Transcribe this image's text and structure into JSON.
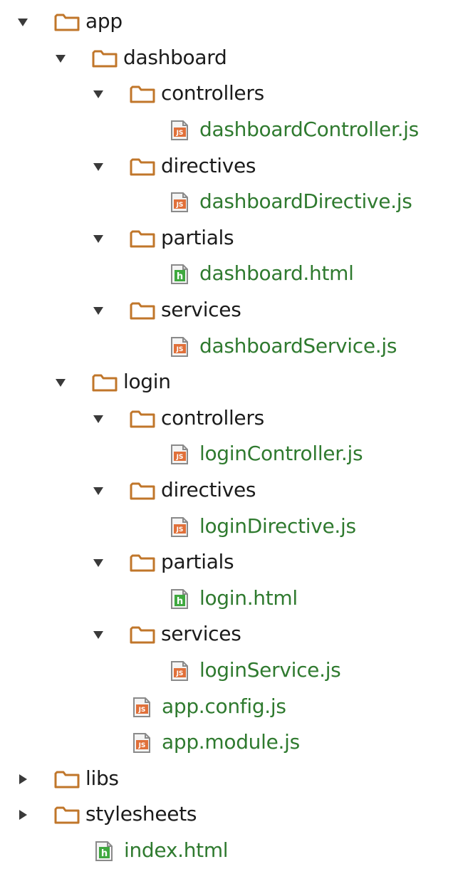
{
  "tree": [
    {
      "label": "app",
      "type": "folder",
      "depth": 0,
      "expanded": true
    },
    {
      "label": "dashboard",
      "type": "folder",
      "depth": 1,
      "expanded": true
    },
    {
      "label": "controllers",
      "type": "folder",
      "depth": 2,
      "expanded": true
    },
    {
      "label": "dashboardController.js",
      "type": "js",
      "depth": 3
    },
    {
      "label": "directives",
      "type": "folder",
      "depth": 2,
      "expanded": true
    },
    {
      "label": "dashboardDirective.js",
      "type": "js",
      "depth": 3
    },
    {
      "label": "partials",
      "type": "folder",
      "depth": 2,
      "expanded": true
    },
    {
      "label": "dashboard.html",
      "type": "html",
      "depth": 3
    },
    {
      "label": "services",
      "type": "folder",
      "depth": 2,
      "expanded": true
    },
    {
      "label": "dashboardService.js",
      "type": "js",
      "depth": 3
    },
    {
      "label": "login",
      "type": "folder",
      "depth": 1,
      "expanded": true
    },
    {
      "label": "controllers",
      "type": "folder",
      "depth": 2,
      "expanded": true
    },
    {
      "label": "loginController.js",
      "type": "js",
      "depth": 3
    },
    {
      "label": "directives",
      "type": "folder",
      "depth": 2,
      "expanded": true
    },
    {
      "label": "loginDirective.js",
      "type": "js",
      "depth": 3
    },
    {
      "label": "partials",
      "type": "folder",
      "depth": 2,
      "expanded": true
    },
    {
      "label": "login.html",
      "type": "html",
      "depth": 3
    },
    {
      "label": "services",
      "type": "folder",
      "depth": 2,
      "expanded": true
    },
    {
      "label": "loginService.js",
      "type": "js",
      "depth": 3
    },
    {
      "label": "app.config.js",
      "type": "js",
      "depth": 2
    },
    {
      "label": "app.module.js",
      "type": "js",
      "depth": 2
    },
    {
      "label": "libs",
      "type": "folder",
      "depth": 0,
      "expanded": false
    },
    {
      "label": "stylesheets",
      "type": "folder",
      "depth": 0,
      "expanded": false
    },
    {
      "label": "index.html",
      "type": "html",
      "depth": 1
    }
  ],
  "colors": {
    "folder_outline": "#c0762a",
    "js_badge": "#e0703a",
    "html_badge": "#3fa83f",
    "file_label": "#2f7a2f",
    "folder_label": "#1b1b1b",
    "arrow": "#3a3a3a"
  },
  "icons": {
    "folder": "folder-icon",
    "js": "js-file-icon",
    "html": "html-file-icon",
    "expanded": "disclosure-down-icon",
    "collapsed": "disclosure-right-icon"
  }
}
